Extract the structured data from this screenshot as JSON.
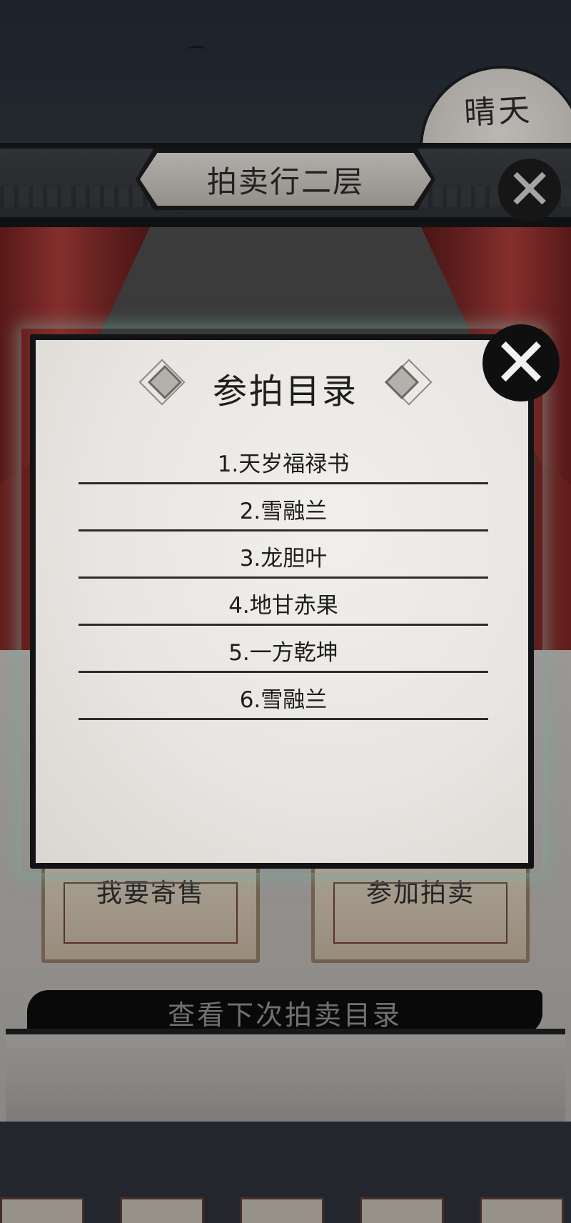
{
  "header": {
    "weather": "晴天",
    "location_title": "拍卖行二层"
  },
  "actions": {
    "sell_button": "我要寄售",
    "join_button": "参加拍卖",
    "next_catalog_button": "查看下次拍卖目录"
  },
  "popup": {
    "title": "参拍目录",
    "items": [
      "1.天岁福禄书",
      "2.雪融兰",
      "3.龙胆叶",
      "4.地甘赤果",
      "5.一方乾坤",
      "6.雪融兰"
    ]
  },
  "icons": {
    "close": "close-icon",
    "diamond": "diamond-ornament-icon"
  }
}
